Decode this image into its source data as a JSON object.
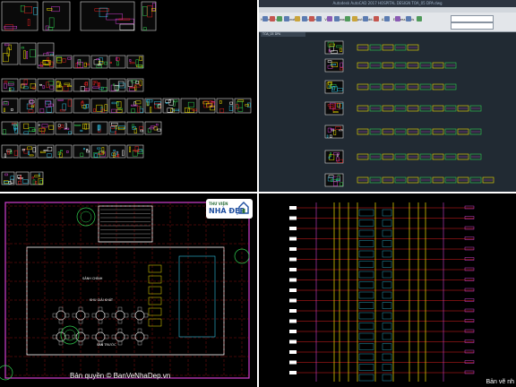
{
  "layout": "four-panel collage of CAD drawings",
  "top_left": {
    "name": "sheet-overview-dark"
  },
  "top_right": {
    "window_title": "Autodesk AutoCAD 2017  HOSPITAL DESIGN   TOA_05 DPA.dwg",
    "ribbon_tabs": [
      "Home",
      "Insert",
      "Annotate",
      "Parametric",
      "View",
      "Manage",
      "Output",
      "Add-ins",
      "A360",
      "Express Tools"
    ],
    "file_tab": "TOA_05 DPA"
  },
  "bottom_left": {
    "logo_small": "THƯ VIỆN",
    "logo_big": "NHÀ ĐẸP",
    "copyright": "Bản quyền © BanVeNhaDep.vn",
    "plan_labels": [
      "SẢNH CHÍNH",
      "KHU GIẢI KHÁT",
      "SÂN TRƯỚC"
    ]
  },
  "bottom_right": {
    "corner_text": "Bản vẽ nh"
  },
  "colors": {
    "cad_background": "#000000",
    "autocad_background": "#212a33",
    "cad_yellow": "#f0e000",
    "cad_red": "#e02020",
    "cad_magenta": "#d040d0",
    "cad_green": "#30d050",
    "cad_cyan": "#30c0e0"
  }
}
